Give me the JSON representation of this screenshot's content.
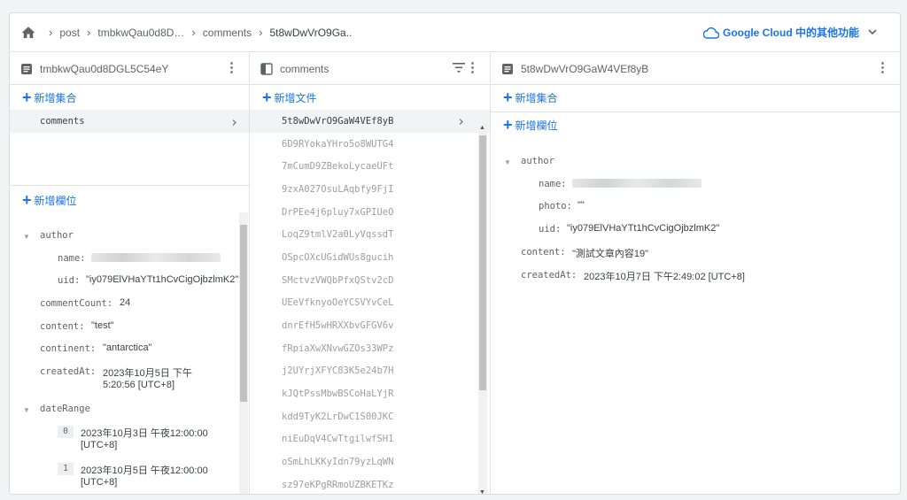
{
  "breadcrumb": {
    "items": [
      "post",
      "tmbkwQau0d8D…",
      "comments",
      "5t8wDwVrO9Ga.."
    ]
  },
  "header": {
    "google_cloud_label": "Google Cloud 中的其他功能"
  },
  "col1": {
    "title": "tmbkwQau0d8DGL5C54eY",
    "add_collection": "新增集合",
    "collection_item": "comments",
    "add_field": "新增欄位",
    "fields": {
      "author_key": "author",
      "name_key": "name:",
      "uid_key": "uid:",
      "uid_val": "\"iy079ElVHaYTt1hCvCigOjbzlmK2\"",
      "commentCount_key": "commentCount:",
      "commentCount_val": "24",
      "content_key": "content:",
      "content_val": "\"test\"",
      "continent_key": "continent:",
      "continent_val": "\"antarctica\"",
      "createdAt_key": "createdAt:",
      "createdAt_val1": "2023年10月5日 下午",
      "createdAt_val2": "5:20:56 [UTC+8]",
      "dateRange_key": "dateRange",
      "dr0_idx": "0",
      "dr0_val1": "2023年10月3日 午夜12:00:00",
      "dr0_val2": "[UTC+8]",
      "dr1_idx": "1",
      "dr1_val1": "2023年10月5日 午夜12:00:00",
      "dr1_val2": "[UTC+8]"
    }
  },
  "col2": {
    "title": "comments",
    "add_document": "新增文件",
    "documents": [
      "5t8wDwVrO9GaW4VEf8yB",
      "6D9RYokaYHro5o8WUTG4",
      "7mCumD9ZBekoLycaeUFt",
      "9zxA027OsuLAqbfy9FjI",
      "DrPEe4j6pluy7xGPIUeO",
      "LoqZ9tmlV2a0LyVqssdT",
      "OSpcOXcUGidWUs8gucih",
      "SMctvzVWQbPfxQStv2cD",
      "UEeVfknyoOeYCSVYvCeL",
      "dnrEfH5wHRXXbvGFGV6v",
      "fRpiaXwXNvwGZOs33WPz",
      "j2UYrjXFYC83K5e24b7H",
      "kJQtPssMbwBSCoHaLYjR",
      "kdd9TyK2LrDwC1S00JKC",
      "niEuDqV4CwTtgilwfSH1",
      "oSmLhLKKyIdn79yzLqWN",
      "sz97eKPgRRmoUZBKETKz"
    ]
  },
  "col3": {
    "title": "5t8wDwVrO9GaW4VEf8yB",
    "add_collection": "新增集合",
    "add_field": "新增欄位",
    "fields": {
      "author_key": "author",
      "name_key": "name:",
      "photo_key": "photo:",
      "photo_val": "\"\"",
      "uid_key": "uid:",
      "uid_val": "\"iy079ElVHaYTt1hCvCigOjbzlmK2\"",
      "content_key": "content:",
      "content_val": "\"測試文章內容19\"",
      "createdAt_key": "createdAt:",
      "createdAt_val": "2023年10月7日 下午2:49:02 [UTC+8]"
    }
  },
  "colors": {
    "accent": "#1a73e8",
    "muted": "#5f6368",
    "border": "#e0e0e0"
  }
}
